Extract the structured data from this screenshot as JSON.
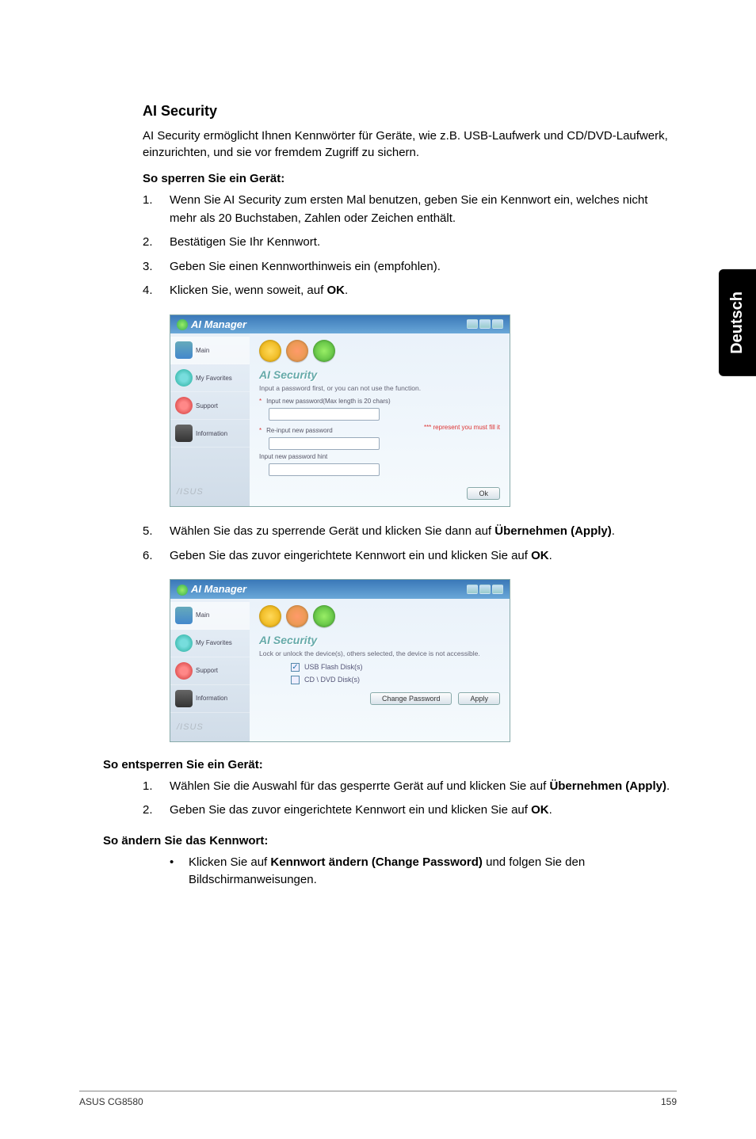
{
  "sideTab": "Deutsch",
  "section": {
    "title": "AI Security",
    "intro": "AI Security ermöglicht Ihnen Kennwörter für Geräte, wie z.B. USB-Laufwerk und CD/DVD-Laufwerk, einzurichten, und sie vor fremdem Zugriff zu sichern."
  },
  "lock": {
    "heading": "So sperren Sie ein Gerät:",
    "steps": [
      "Wenn Sie AI Security zum ersten Mal benutzen, geben Sie ein Kennwort ein, welches nicht mehr als 20 Buchstaben, Zahlen oder Zeichen enthält.",
      "Bestätigen Sie Ihr Kennwort.",
      "Geben Sie einen Kennworthinweis ein (empfohlen).",
      "Klicken Sie, wenn soweit, auf "
    ],
    "step4_bold": "OK",
    "step4_suffix": ".",
    "step5_pre": "Wählen Sie das zu sperrende Gerät und klicken Sie dann auf ",
    "step5_bold": "Übernehmen (Apply)",
    "step5_suffix": ".",
    "step6_pre": "Geben Sie das zuvor eingerichtete Kennwort ein und klicken Sie auf ",
    "step6_bold": "OK",
    "step6_suffix": "."
  },
  "unlock": {
    "heading": "So entsperren Sie ein Gerät:",
    "step1_pre": "Wählen Sie die Auswahl für das gesperrte Gerät auf und klicken Sie auf ",
    "step1_bold": "Übernehmen (Apply)",
    "step1_suffix": ".",
    "step2_pre": "Geben Sie das zuvor eingerichtete Kennwort ein und klicken Sie auf ",
    "step2_bold": "OK",
    "step2_suffix": "."
  },
  "change": {
    "heading": "So ändern Sie das Kennwort:",
    "bullet_pre": "Klicken Sie auf ",
    "bullet_bold": "Kennwort ändern (Change Password)",
    "bullet_suffix": " und folgen Sie den Bildschirmanweisungen."
  },
  "screenshot1": {
    "title": "AI Manager",
    "side": {
      "main": "Main",
      "fav": "My Favorites",
      "support": "Support",
      "info": "Information"
    },
    "panelTitle": "AI Security",
    "hint": "Input a password first, or you can not use the function.",
    "fieldNew": "Input new password(Max length is 20 chars)",
    "fieldRe": "Re-input new password",
    "fieldHint": "Input new password hint",
    "warn": "*** represent you must fill it",
    "ok": "Ok",
    "logo": "/ISUS"
  },
  "screenshot2": {
    "title": "AI Manager",
    "side": {
      "main": "Main",
      "fav": "My Favorites",
      "support": "Support",
      "info": "Information"
    },
    "panelTitle": "AI Security",
    "hint": "Lock or unlock the device(s), others selected, the device is not accessible.",
    "dev1": "USB Flash Disk(s)",
    "dev2": "CD \\ DVD Disk(s)",
    "changeBtn": "Change Password",
    "applyBtn": "Apply",
    "logo": "/ISUS"
  },
  "footer": {
    "left": "ASUS CG8580",
    "right": "159"
  }
}
